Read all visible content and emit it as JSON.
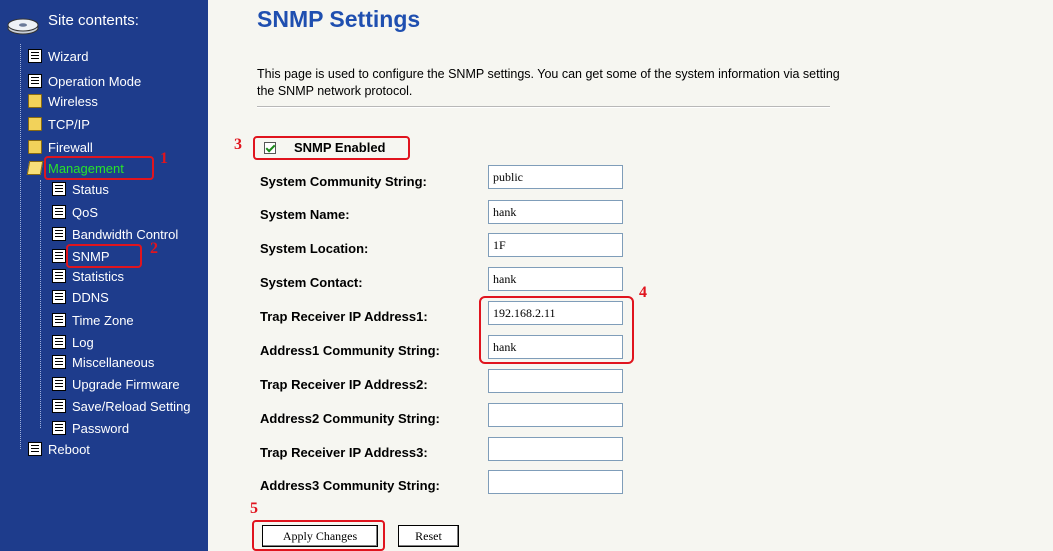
{
  "sidebar": {
    "title": "Site contents:",
    "items": [
      {
        "label": "Wizard",
        "icon": "page-icon"
      },
      {
        "label": "Operation Mode",
        "icon": "page-icon"
      },
      {
        "label": "Wireless",
        "icon": "folder-icon"
      },
      {
        "label": "TCP/IP",
        "icon": "folder-icon"
      },
      {
        "label": "Firewall",
        "icon": "folder-icon"
      },
      {
        "label": "Management",
        "icon": "open-folder-icon",
        "active": true
      },
      {
        "label": "Status",
        "icon": "page-icon"
      },
      {
        "label": "QoS",
        "icon": "page-icon"
      },
      {
        "label": "Bandwidth Control",
        "icon": "page-icon"
      },
      {
        "label": "SNMP",
        "icon": "page-icon"
      },
      {
        "label": "Statistics",
        "icon": "page-icon"
      },
      {
        "label": "DDNS",
        "icon": "page-icon"
      },
      {
        "label": "Time Zone",
        "icon": "page-icon"
      },
      {
        "label": "Log",
        "icon": "page-icon"
      },
      {
        "label": "Miscellaneous",
        "icon": "page-icon"
      },
      {
        "label": "Upgrade Firmware",
        "icon": "page-icon"
      },
      {
        "label": "Save/Reload Setting",
        "icon": "page-icon"
      },
      {
        "label": "Password",
        "icon": "page-icon"
      },
      {
        "label": "Reboot",
        "icon": "page-icon"
      }
    ]
  },
  "annotations": {
    "n1": "1",
    "n2": "2",
    "n3": "3",
    "n4": "4",
    "n5": "5"
  },
  "main": {
    "title": "SNMP Settings",
    "description": "This page is used to configure the SNMP settings. You can get some of the system information via setting the SNMP network protocol.",
    "snmp_enabled_label": "SNMP Enabled",
    "snmp_enabled": true,
    "fields": [
      {
        "label": "System Community String:",
        "value": "public"
      },
      {
        "label": "System Name:",
        "value": "hank"
      },
      {
        "label": "System Location:",
        "value": "1F"
      },
      {
        "label": "System Contact:",
        "value": "hank"
      },
      {
        "label": "Trap Receiver IP Address1:",
        "value": "192.168.2.11"
      },
      {
        "label": "Address1 Community String:",
        "value": "hank"
      },
      {
        "label": "Trap Receiver IP Address2:",
        "value": ""
      },
      {
        "label": "Address2 Community String:",
        "value": ""
      },
      {
        "label": "Trap Receiver IP Address3:",
        "value": ""
      },
      {
        "label": "Address3 Community String:",
        "value": ""
      }
    ],
    "apply_label": "Apply Changes",
    "reset_label": "Reset"
  },
  "colors": {
    "sidebar_bg": "#1e3c8c",
    "active_item": "#28e428",
    "title": "#1f4fb0",
    "annotation": "#e0141e"
  }
}
